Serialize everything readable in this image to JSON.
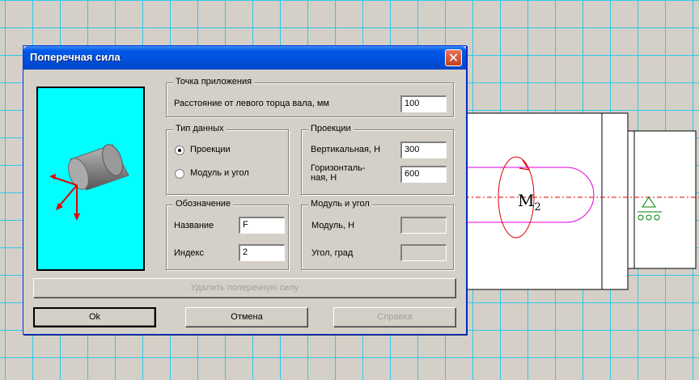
{
  "drawing": {
    "moment_label": "M",
    "moment_subscript": "2"
  },
  "dialog": {
    "title": "Поперечная сила",
    "close_icon": "close-icon",
    "application_point": {
      "legend": "Точка приложения",
      "distance_label": "Расстояние от левого торца вала, мм",
      "distance_value": "100"
    },
    "data_type": {
      "legend": "Тип данных",
      "option_projections": "Проекции",
      "option_modulus_angle": "Модуль и угол",
      "selected": "Проекции"
    },
    "projections": {
      "legend": "Проекции",
      "vertical_label": "Вертикальная, Н",
      "vertical_value": "300",
      "horizontal_label_line1": "Горизонталь-",
      "horizontal_label_line2": "ная, Н",
      "horizontal_value": "600"
    },
    "designation": {
      "legend": "Обозначение",
      "name_label": "Название",
      "name_value": "F",
      "index_label": "Индекс",
      "index_value": "2"
    },
    "modulus_angle": {
      "legend": "Модуль и угол",
      "modulus_label": "Модуль, Н",
      "modulus_value": "",
      "angle_label": "Угол, град",
      "angle_value": ""
    },
    "delete_button": "Удалить поперечную силу",
    "ok_button": "Ok",
    "cancel_button": "Отмена",
    "help_button": "Справка"
  },
  "colors": {
    "grid": "#2ec8e8",
    "preview_bg": "#00ffff",
    "title_bar": "#0058e6",
    "centerline": "#e00000",
    "shaft_outline": "#e000e0"
  }
}
